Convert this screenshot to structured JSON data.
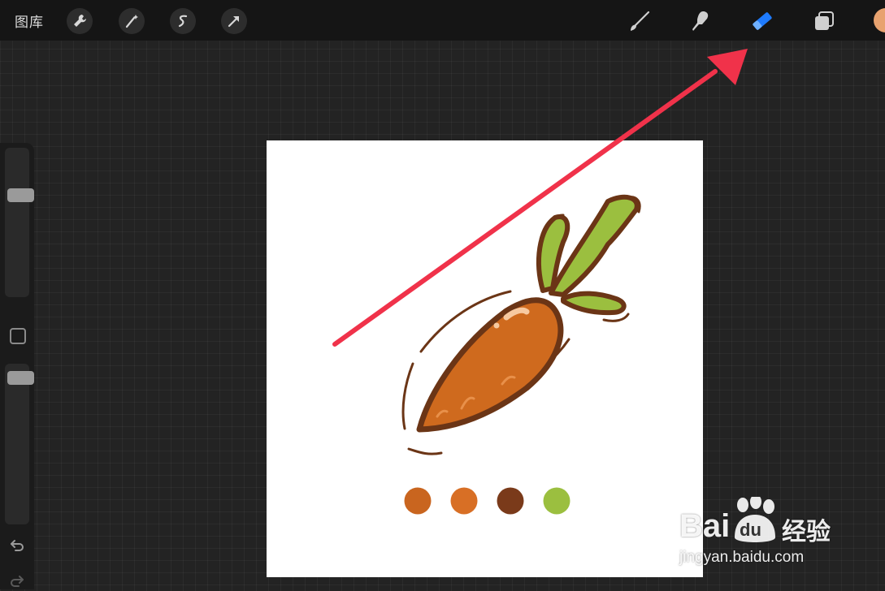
{
  "toolbar": {
    "gallery_label": "图库",
    "left_tools": [
      "wrench-icon",
      "magic-wand-icon",
      "selection-icon",
      "transform-arrow-icon"
    ],
    "right_tools": [
      "brush-icon",
      "smudge-icon",
      "eraser-icon",
      "layers-icon"
    ],
    "active_tool": "eraser",
    "active_tool_color": "#1e7bff",
    "current_color": "#e8a26f"
  },
  "sidebar": {
    "brush_size_level": 0.7,
    "opacity_level": 0.95
  },
  "canvas": {
    "background": "#ffffff",
    "palette": [
      "#c9651f",
      "#d86f25",
      "#7a3a1a",
      "#9bbf3f"
    ]
  },
  "annotation": {
    "arrow_color": "#f0324a"
  },
  "watermark": {
    "brand": "Bai",
    "brand_du": "du",
    "brand_cn": "经验",
    "url": "jingyan.baidu.com"
  }
}
